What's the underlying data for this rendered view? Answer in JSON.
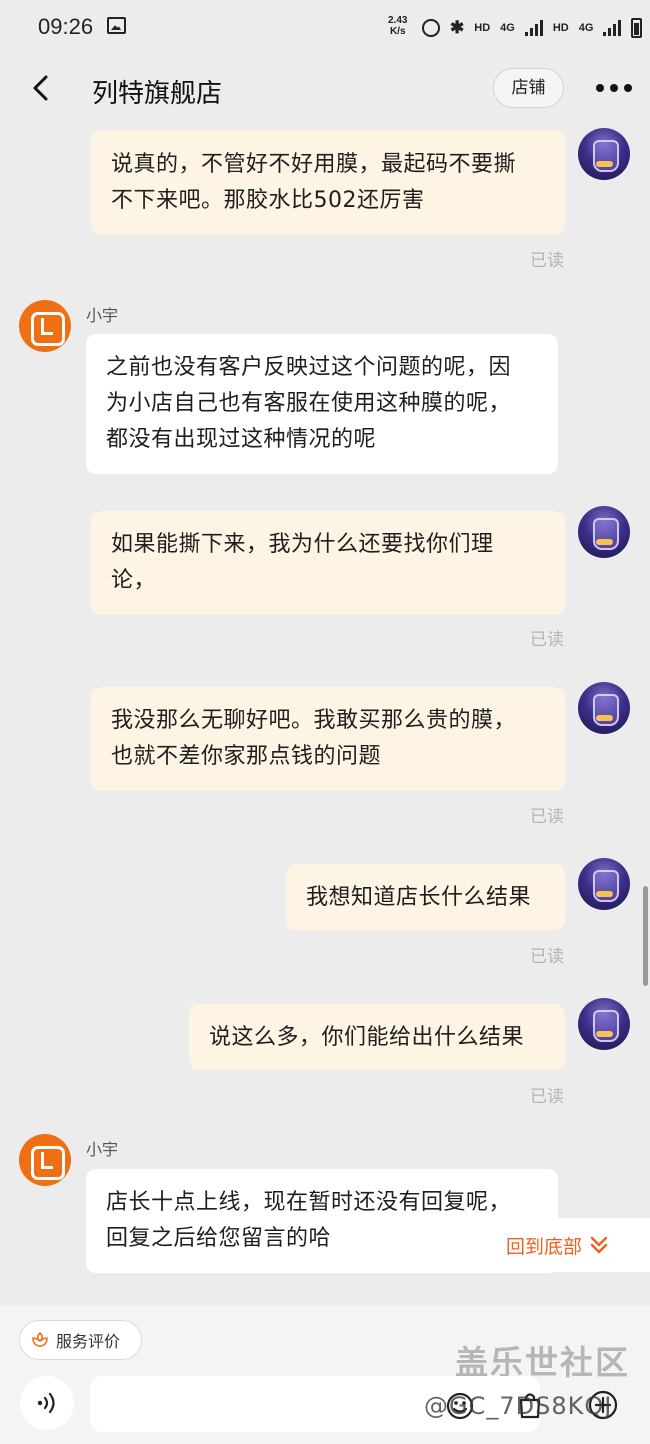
{
  "status_bar": {
    "time": "09:26",
    "net_speed_value": "2.43",
    "net_speed_unit": "K/s",
    "hd1": "HD",
    "sig1": "4G",
    "hd2": "HD",
    "sig2": "4G"
  },
  "header": {
    "title": "列特旗舰店",
    "shop_button": "店铺"
  },
  "messages": [
    {
      "from": "me",
      "lines": [
        "说真的，不管好不好用膜，最起码不要撕",
        "不下来吧。那胶水比502还厉害"
      ],
      "status": "已读"
    },
    {
      "from": "shop",
      "sender": "小宇",
      "lines": [
        "之前也没有客户反映过这个问题的呢，因",
        "为小店自己也有客服在使用这种膜的呢，",
        "都没有出现过这种情况的呢"
      ]
    },
    {
      "from": "me",
      "lines": [
        "如果能撕下来，我为什么还要找你们理",
        "论，"
      ],
      "status": "已读"
    },
    {
      "from": "me",
      "lines": [
        "我没那么无聊好吧。我敢买那么贵的膜，",
        "也就不差你家那点钱的问题"
      ],
      "status": "已读"
    },
    {
      "from": "me",
      "lines": [
        "我想知道店长什么结果"
      ],
      "status": "已读"
    },
    {
      "from": "me",
      "lines": [
        "说这么多，你们能给出什么结果"
      ],
      "status": "已读"
    },
    {
      "from": "shop",
      "sender": "小宇",
      "lines": [
        "店长十点上线，现在暂时还没有回复呢，",
        "回复之后给您留言的哈"
      ]
    }
  ],
  "jump_to_bottom": "回到底部",
  "bottom_bar": {
    "rating_label": "服务评价",
    "input_placeholder": ""
  },
  "watermark": {
    "title": "盖乐世社区",
    "user": "@GC_7DS8KQJ"
  },
  "colors": {
    "outgoing_bubble": "#fdf4e3",
    "incoming_bubble": "#ffffff",
    "accent": "#ef5f1f",
    "shop_avatar": "#ef6f14"
  }
}
